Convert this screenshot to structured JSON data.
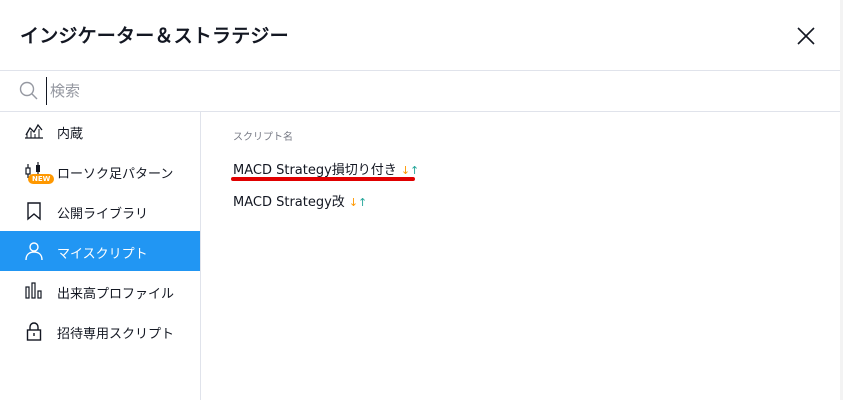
{
  "dialog": {
    "title": "インジケーター＆ストラテジー"
  },
  "search": {
    "placeholder": "検索",
    "value": ""
  },
  "sidebar": {
    "items": [
      {
        "label": "内蔵",
        "icon": "chart-line-icon"
      },
      {
        "label": "ローソク足パターン",
        "icon": "candlestick-icon",
        "badge": "NEW"
      },
      {
        "label": "公開ライブラリ",
        "icon": "bookmark-icon"
      },
      {
        "label": "マイスクリプト",
        "icon": "user-icon",
        "active": true
      },
      {
        "label": "出来高プロファイル",
        "icon": "volume-bars-icon"
      },
      {
        "label": "招待専用スクリプト",
        "icon": "lock-icon"
      }
    ]
  },
  "content": {
    "column_header": "スクリプト名",
    "scripts": [
      {
        "name": "MACD Strategy損切り付き",
        "arrow_down": "↓",
        "arrow_up": "↑"
      },
      {
        "name": "MACD Strategy改",
        "arrow_down": "↓",
        "arrow_up": "↑"
      }
    ]
  },
  "colors": {
    "accent": "#2196f3",
    "badge": "#ff9800",
    "arrow_down": "#ff9800",
    "arrow_up": "#26a69a",
    "annotation_underline": "#e00000"
  }
}
